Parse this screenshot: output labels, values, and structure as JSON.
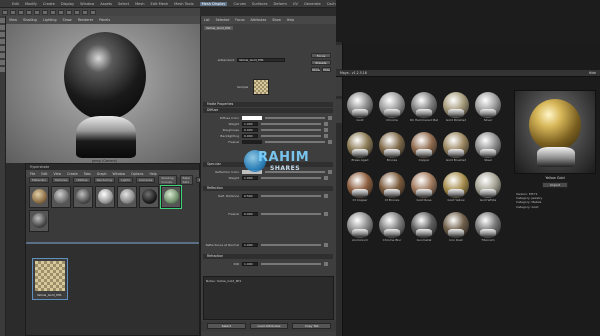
{
  "menubar": {
    "items": [
      "Edit",
      "Modify",
      "Create",
      "Display",
      "Window",
      "Assets",
      "Select",
      "Mesh",
      "Edit Mesh",
      "Mesh Tools",
      "Mesh Display",
      "Curves",
      "Surfaces",
      "Deform",
      "UV",
      "Generate",
      "Cache",
      "Rendering",
      "Help",
      "Arnold"
    ]
  },
  "viewport": {
    "menu": [
      "View",
      "Shading",
      "Lighting",
      "Show",
      "Renderer",
      "Panels"
    ],
    "camera_label": "persp (Camera)"
  },
  "hypershade": {
    "title_items": [
      "Hypershade"
    ],
    "menu": [
      "File",
      "Edit",
      "View",
      "Create",
      "Tabs",
      "Graph",
      "Window",
      "Options",
      "Help"
    ],
    "tabs": [
      "Materials",
      "Textures",
      "Utilities",
      "Rendering",
      "Lights",
      "Cameras",
      "Shading Groups",
      "Bake Sets",
      "Projects",
      "Asset Nodes"
    ],
    "swatch_labels": [
      "",
      "",
      "",
      "",
      "",
      "",
      "yellowCond"
    ],
    "node_label": "Yellow_Gold_Mt1"
  },
  "attr": {
    "head": [
      "List",
      "Selected",
      "Focus",
      "Attributes",
      "Show",
      "Help"
    ],
    "tabs": [
      "Yellow_Gold_Mt1"
    ],
    "shader_label": "aiStandard:",
    "shader_name": "Yellow_Gold_Mt1",
    "focus_btn": "Focus",
    "presets_btn": "Presets",
    "show_btn": "Show",
    "hide_btn": "Hide",
    "sample_label": "Sample",
    "sections": [
      "Matte Properties",
      "Diffuse",
      "Specular",
      "Reflection",
      "Refraction"
    ],
    "params": [
      {
        "label": "Diffuse Color",
        "value": ""
      },
      {
        "label": "Weight",
        "value": "1.000"
      },
      {
        "label": "Roughness",
        "value": "0.000"
      },
      {
        "label": "Backlighting",
        "value": "0.000"
      },
      {
        "label": "Fresnel",
        "value": ""
      }
    ],
    "spec_params": [
      {
        "label": "Reflection Color",
        "value": ""
      },
      {
        "label": "Weight",
        "value": "1.000"
      },
      {
        "label": "Refl. Distance",
        "value": "0.500"
      },
      {
        "label": "Fresnel",
        "value": "0.000"
      },
      {
        "label": "Reflectance at Normal",
        "value": "1.000"
      },
      {
        "label": "IOR",
        "value": "1.000"
      }
    ],
    "notes_label": "Notes: Yellow_Gold_Mt1",
    "bottom_buttons": [
      "Select",
      "Load Attributes",
      "Copy Tab"
    ]
  },
  "watermark": {
    "big": "RAHIM",
    "small": "SHARES"
  },
  "rightpanel": {
    "title": "Maya - v1.2.5.16",
    "close": "Hide",
    "materials": [
      {
        "label": "Gold",
        "color": "#8a8a8a"
      },
      {
        "label": "Chrome",
        "color": "#9a9a9a"
      },
      {
        "label": "Dk Hammered Metal",
        "color": "#7e7e7e"
      },
      {
        "label": "Gold Polished",
        "color": "#a59a7a"
      },
      {
        "label": "Silver",
        "color": "#9e9e9e"
      },
      {
        "label": "Brass Aged",
        "color": "#8b7a55"
      },
      {
        "label": "Bronze",
        "color": "#7f6a4a"
      },
      {
        "label": "Copper",
        "color": "#8f6a4e"
      },
      {
        "label": "Gold Brushed",
        "color": "#9a8660"
      },
      {
        "label": "Steel",
        "color": "#8e8e8e"
      },
      {
        "label": "Ct Copper",
        "color": "#8d5f40"
      },
      {
        "label": "Ct Bronze",
        "color": "#7a5a3c"
      },
      {
        "label": "Gold Rose",
        "color": "#a07a5e"
      },
      {
        "label": "Gold Yellow",
        "color": "#a88f4f"
      },
      {
        "label": "Gold White",
        "color": "#a7a596"
      },
      {
        "label": "Aluminium",
        "color": "#8d8d8d"
      },
      {
        "label": "Chrome Blur",
        "color": "#7c7c7c"
      },
      {
        "label": "Gunmetal",
        "color": "#5e5e5e"
      },
      {
        "label": "Iron Rust",
        "color": "#6f5f4a"
      },
      {
        "label": "Titanium",
        "color": "#777777"
      }
    ],
    "preview_label": "Yellow Gold",
    "preview_button": "Import",
    "info": [
      "Version: MT-Y1",
      "Category: Jewelry",
      "Category: Metals",
      "Category: Gold"
    ]
  }
}
